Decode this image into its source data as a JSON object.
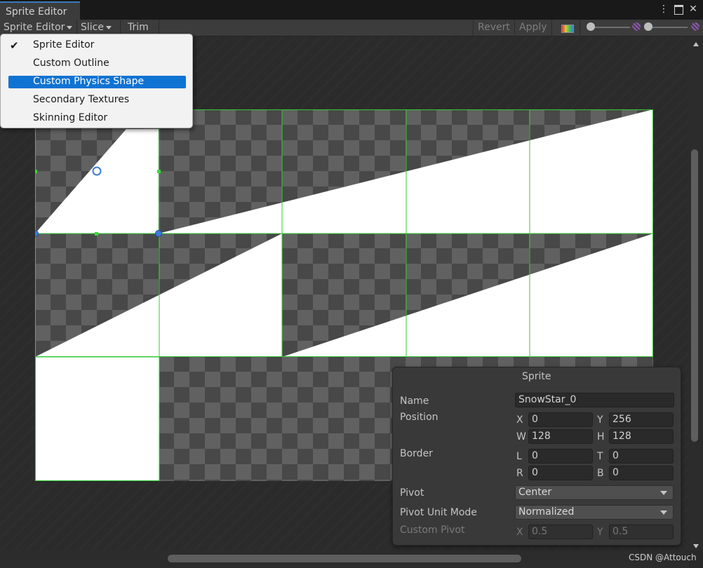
{
  "window": {
    "tab_title": "Sprite Editor"
  },
  "toolbar": {
    "mode_label": "Sprite Editor",
    "slice_label": "Slice",
    "trim_label": "Trim",
    "revert_label": "Revert",
    "apply_label": "Apply"
  },
  "menu": {
    "items": [
      {
        "label": "Sprite Editor",
        "checked": true
      },
      {
        "label": "Custom Outline"
      },
      {
        "label": "Custom Physics Shape",
        "highlighted": true
      },
      {
        "label": "Secondary Textures"
      },
      {
        "label": "Skinning Editor"
      }
    ]
  },
  "panel": {
    "title": "Sprite",
    "name_label": "Name",
    "name_value": "SnowStar_0",
    "position_label": "Position",
    "pos": {
      "x_label": "X",
      "x": "0",
      "y_label": "Y",
      "y": "256",
      "w_label": "W",
      "w": "128",
      "h_label": "H",
      "h": "128"
    },
    "border_label": "Border",
    "border": {
      "l_label": "L",
      "l": "0",
      "t_label": "T",
      "t": "0",
      "r_label": "R",
      "r": "0",
      "b_label": "B",
      "b": "0"
    },
    "pivot_label": "Pivot",
    "pivot_value": "Center",
    "pivot_unit_label": "Pivot Unit Mode",
    "pivot_unit_value": "Normalized",
    "custom_pivot_label": "Custom Pivot",
    "custom_pivot": {
      "x_label": "X",
      "x": "0.5",
      "y_label": "Y",
      "y": "0.5"
    }
  },
  "colors": {
    "accent": "#0f73d3",
    "sprite_rect": "#33cc33",
    "handle": "#3a7be0"
  },
  "watermark": "CSDN @Attouch"
}
